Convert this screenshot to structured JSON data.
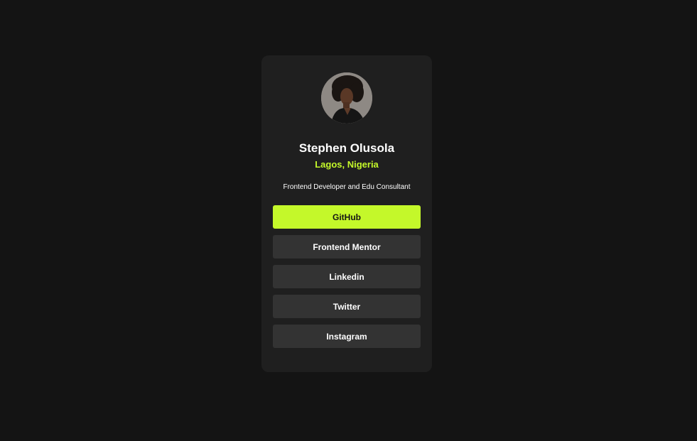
{
  "profile": {
    "name": "Stephen Olusola",
    "location": "Lagos, Nigeria",
    "bio": "Frontend Developer and Edu Consultant"
  },
  "links": [
    {
      "label": "GitHub",
      "active": true
    },
    {
      "label": "Frontend Mentor",
      "active": false
    },
    {
      "label": "Linkedin",
      "active": false
    },
    {
      "label": "Twitter",
      "active": false
    },
    {
      "label": "Instagram",
      "active": false
    }
  ],
  "colors": {
    "page_background": "#141414",
    "card_background": "#1f1f1f",
    "accent": "#c4f82a",
    "button_background": "#333333",
    "text": "#ffffff"
  }
}
